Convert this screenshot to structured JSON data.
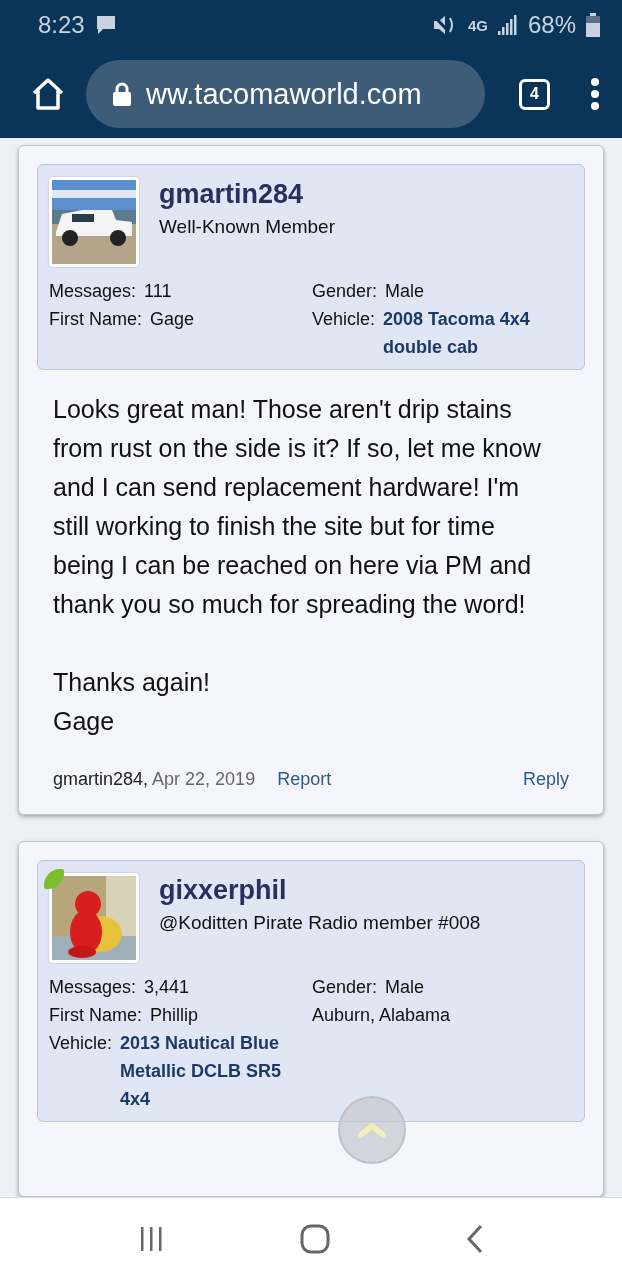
{
  "status_bar": {
    "time": "8:23",
    "network": "4G",
    "battery": "68%"
  },
  "browser": {
    "url": "ww.tacomaworld.com",
    "tab_count": "4"
  },
  "posts": [
    {
      "username": "gmartin284",
      "title": "Well-Known Member",
      "online": false,
      "avatar": {
        "kind": "picture"
      },
      "left_fields": [
        {
          "label": "Messages:",
          "value": "111",
          "link": false
        },
        {
          "label": "First Name:",
          "value": "Gage",
          "link": false
        }
      ],
      "right_fields": [
        {
          "label": "Gender:",
          "value": "Male",
          "link": false
        },
        {
          "label": "Vehicle:",
          "value": "2008 Tacoma 4x4 double cab",
          "link": true
        }
      ],
      "message": [
        [
          "Looks great man! Those aren't drip stains from rust on the side is it? If so, let me know and I can send replacement hardware! I'm still working to finish the site but for time being I can be reached on here via PM and thank you so much for spreading the word!"
        ],
        [
          "Thanks again!",
          "Gage"
        ]
      ],
      "footer": {
        "author": "gmartin284,",
        "date": "Apr 22, 2019",
        "report": "Report",
        "reply": "Reply"
      }
    },
    {
      "username": "gixxerphil",
      "title": "@Koditten Pirate Radio member #008",
      "online": true,
      "avatar": {
        "kind": "picture"
      },
      "left_fields": [
        {
          "label": "Messages:",
          "value": "3,441",
          "link": false
        },
        {
          "label": "First Name:",
          "value": "Phillip",
          "link": false
        },
        {
          "label": "Vehicle:",
          "value": "2013 Nautical Blue Metallic DCLB SR5 4x4",
          "link": true
        }
      ],
      "right_fields": [
        {
          "label": "Gender:",
          "value": "Male",
          "link": false
        },
        {
          "value": "Auburn, Alabama",
          "link": false
        }
      ]
    }
  ]
}
